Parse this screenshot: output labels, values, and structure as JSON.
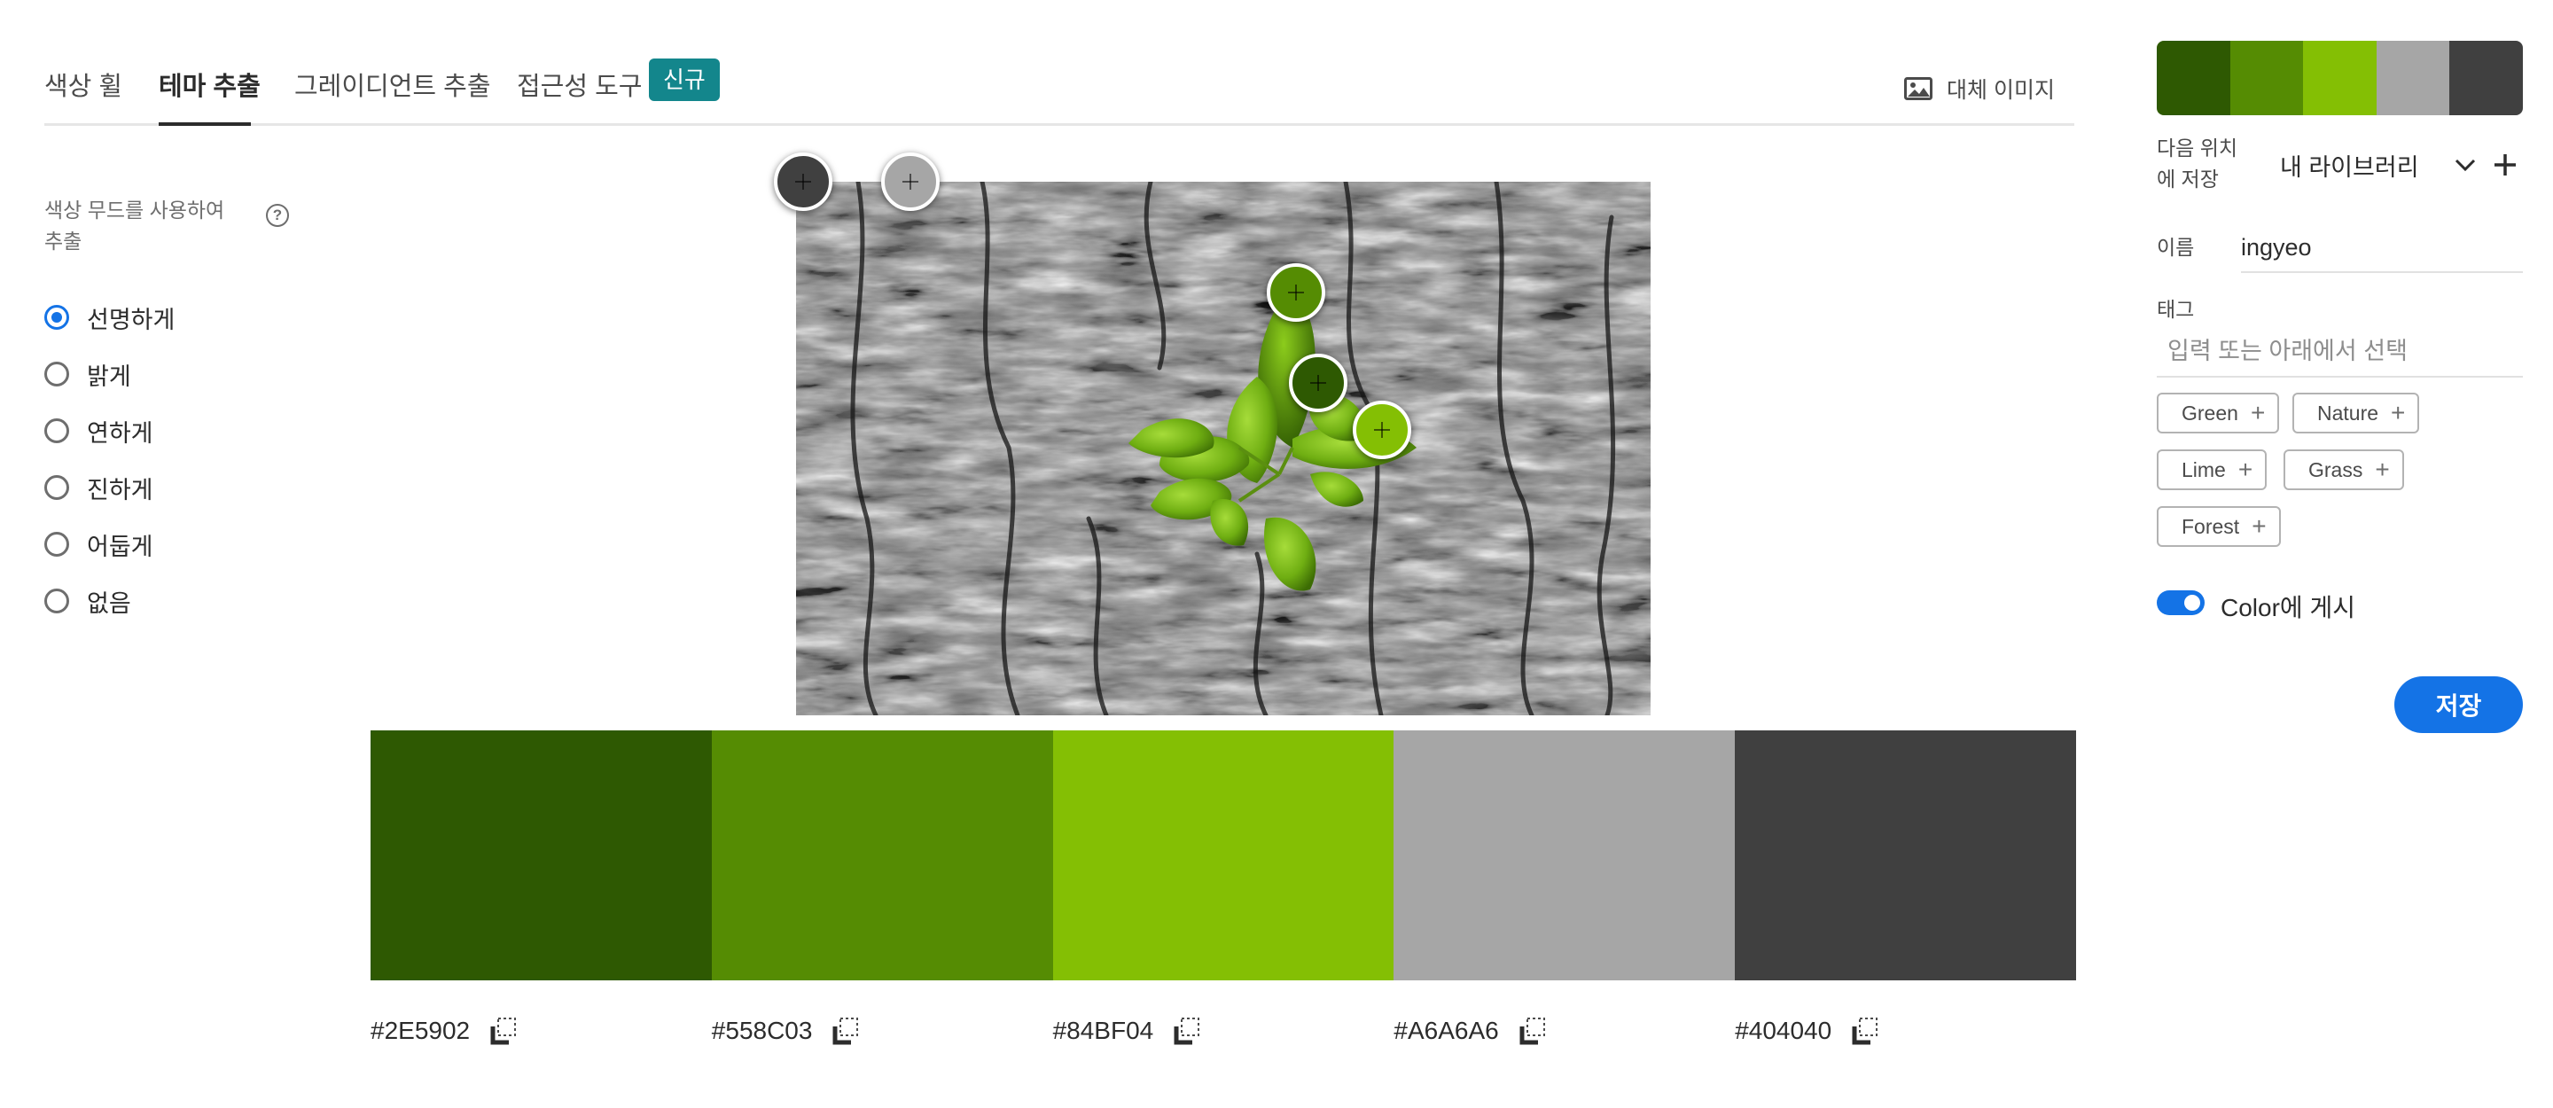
{
  "tabs": {
    "items": [
      {
        "label": "색상 휠"
      },
      {
        "label": "테마 추출"
      },
      {
        "label": "그레이디언트 추출"
      },
      {
        "label": "접근성 도구"
      }
    ],
    "active": "테마 추출",
    "badge": "신규",
    "alt_image": {
      "label": "대체 이미지",
      "icon": "image-icon"
    }
  },
  "mood": {
    "label": "색상 무드를 사용하여 추출",
    "help_icon": "?",
    "options": [
      "선명하게",
      "밝게",
      "연하게",
      "진하게",
      "어둡게",
      "없음"
    ],
    "selected": "선명하게"
  },
  "palette": [
    {
      "hex": "#2E5902",
      "color": "#2E5902"
    },
    {
      "hex": "#558C03",
      "color": "#558C03"
    },
    {
      "hex": "#84BF04",
      "color": "#84BF04"
    },
    {
      "hex": "#A6A6A6",
      "color": "#A6A6A6"
    },
    {
      "hex": "#404040",
      "color": "#404040"
    }
  ],
  "sidebar": {
    "save_to_label": "다음 위치에 저장",
    "library": "내 라이브러리",
    "name_label": "이름",
    "name_value": "ingyeo",
    "tag_label": "태그",
    "tag_placeholder": "입력 또는 아래에서 선택",
    "tags": [
      "Green",
      "Nature",
      "Lime",
      "Grass",
      "Forest"
    ],
    "publish_label": "Color에 게시",
    "publish_on": true,
    "save_label": "저장",
    "accent_color": "#1473E6"
  }
}
